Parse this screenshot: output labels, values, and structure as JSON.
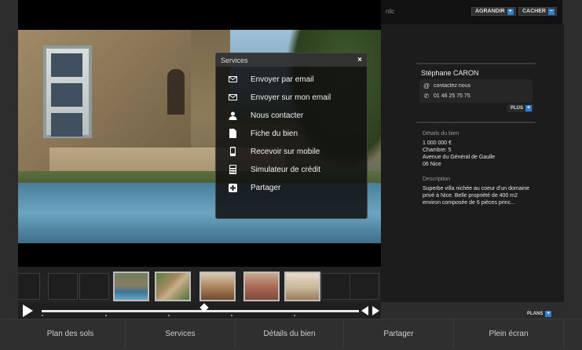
{
  "header": {
    "floor_label": "rdc",
    "enlarge_label": "AGRANDIR",
    "hide_label": "CACHER",
    "enlarge_icon": "plus-icon",
    "hide_icon": "minus-icon"
  },
  "services_popup": {
    "title": "Services",
    "close": "×",
    "items": [
      {
        "label": "Envoyer par email",
        "icon": "envelope-icon"
      },
      {
        "label": "Envoyer sur mon email",
        "icon": "envelope-icon"
      },
      {
        "label": "Nous contacter",
        "icon": "person-icon"
      },
      {
        "label": "Fiche du bien",
        "icon": "document-icon"
      },
      {
        "label": "Recevoir sur mobile",
        "icon": "mobile-icon"
      },
      {
        "label": "Simulateur de crédit",
        "icon": "calculator-icon"
      },
      {
        "label": "Partager",
        "icon": "plus-square-icon"
      }
    ]
  },
  "agent": {
    "name": "Stéphane CARON",
    "contact_label": "contactez nous",
    "phone": "01 46 25 75 75",
    "more_label": "PLUS"
  },
  "details": {
    "title": "Détails du bien",
    "price": "1 000 000 €",
    "rooms": "Chambre: 5",
    "address": "Avenue du Général de Gaulle",
    "city": "06 Nice",
    "description_title": "Description",
    "description": "Superbe villa nichée au coeur d'un domaine privé à Nice. Belle propriété de 400 m2 environ composée de 6 pièces princ..."
  },
  "plans_label": "PLANS",
  "bottom_nav": [
    {
      "label": "Plan des sols"
    },
    {
      "label": "Services"
    },
    {
      "label": "Détails du bien"
    },
    {
      "label": "Partager"
    },
    {
      "label": "Plein écran"
    }
  ],
  "colors": {
    "accent": "#2f7fd0",
    "panel": "#1c1c1c",
    "nav": "#2f2f2f"
  }
}
